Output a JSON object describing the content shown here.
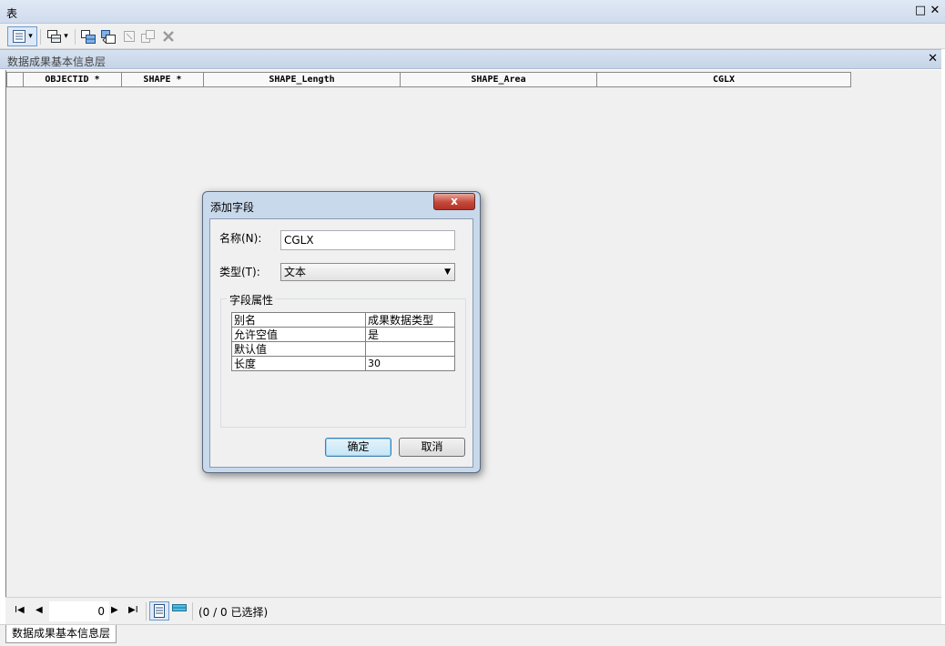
{
  "window": {
    "title": "表",
    "restore_glyph": "□",
    "close_glyph": "✕"
  },
  "toolbar": {
    "table_options_icon": "table-options-icon",
    "dropdown_glyph": "▾",
    "buttons": [
      "related-tables-icon",
      "select-by-attributes-icon",
      "switch-selection-icon",
      "clear-selection-icon",
      "zoom-to-selected-icon",
      "delete-selected-icon"
    ]
  },
  "layer_tab": {
    "name": "数据成果基本信息层",
    "close_glyph": "✕"
  },
  "grid": {
    "columns": [
      "",
      "OBJECTID *",
      "SHAPE *",
      "SHAPE_Length",
      "SHAPE_Area",
      "CGLX"
    ]
  },
  "nav": {
    "first_glyph": "I◀",
    "prev_glyph": "◀",
    "record_value": "0",
    "next_glyph": "▶",
    "last_glyph": "▶I",
    "status": "(0 / 0 已选择)"
  },
  "bottom_tab": {
    "name": "数据成果基本信息层"
  },
  "dialog": {
    "title": "添加字段",
    "close_glyph": "x",
    "name_label": "名称(N):",
    "name_value": "CGLX",
    "type_label": "类型(T):",
    "type_value": "文本",
    "type_arrow": "▼",
    "props_legend": "字段属性",
    "properties": [
      {
        "key": "别名",
        "value": "成果数据类型"
      },
      {
        "key": "允许空值",
        "value": "是"
      },
      {
        "key": "默认值",
        "value": ""
      },
      {
        "key": "长度",
        "value": "30"
      }
    ],
    "ok_label": "确定",
    "cancel_label": "取消"
  },
  "colors": {
    "title_bar": "#cfdced",
    "layer_tab": "#c6d4e7",
    "dialog_frame": "#c9d9ec",
    "close_red": "#c4493b"
  }
}
